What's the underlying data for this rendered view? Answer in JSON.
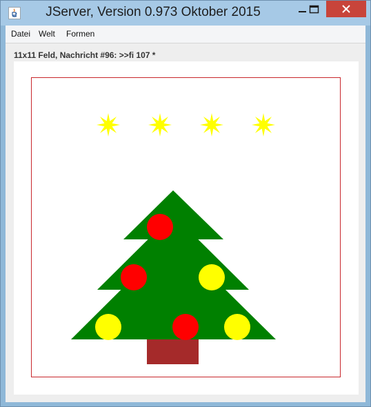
{
  "window": {
    "title": "JServer, Version 0.973 Oktober 2015"
  },
  "menu": {
    "items": [
      "Datei",
      "Welt",
      "Formen"
    ]
  },
  "status_line": "11x11 Feld, Nachricht #96: >>fi 107 *",
  "scene": {
    "colors": {
      "star": "#ffff00",
      "tree": "#008000",
      "trunk": "#a52a2a",
      "ball_red": "#ff0000",
      "ball_yellow": "#ffff00",
      "frame": "#c8262b"
    }
  }
}
